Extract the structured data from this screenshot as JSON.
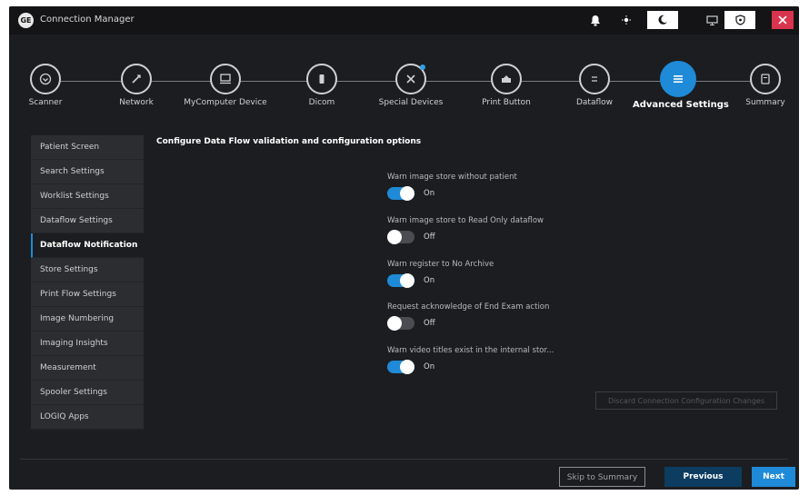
{
  "window": {
    "title": "Connection Manager",
    "logo_text": "GE"
  },
  "titlebar": {
    "icons": [
      "bell-icon",
      "sun-icon",
      "moon-icon",
      "monitor-icon",
      "shield-icon",
      "close-icon"
    ]
  },
  "steps": [
    {
      "label": "Scanner",
      "icon": "scanner-icon"
    },
    {
      "label": "Network",
      "icon": "network-icon"
    },
    {
      "label": "MyComputer Device",
      "icon": "computer-icon"
    },
    {
      "label": "Dicom",
      "icon": "dicom-icon"
    },
    {
      "label": "Special Devices",
      "icon": "tools-icon"
    },
    {
      "label": "Print Button",
      "icon": "printer-icon"
    },
    {
      "label": "Dataflow",
      "icon": "dataflow-icon"
    },
    {
      "label": "Advanced Settings",
      "icon": "list-icon"
    },
    {
      "label": "Summary",
      "icon": "summary-icon"
    }
  ],
  "active_step": "Advanced Settings",
  "sidebar": {
    "items": [
      {
        "label": "Patient Screen"
      },
      {
        "label": "Search Settings"
      },
      {
        "label": "Worklist Settings"
      },
      {
        "label": "Dataflow Settings"
      },
      {
        "label": "Dataflow Notification"
      },
      {
        "label": "Store Settings"
      },
      {
        "label": "Print Flow Settings"
      },
      {
        "label": "Image Numbering"
      },
      {
        "label": "Imaging Insights"
      },
      {
        "label": "Measurement"
      },
      {
        "label": "Spooler Settings"
      },
      {
        "label": "LOGIQ Apps"
      }
    ],
    "active": "Dataflow Notification"
  },
  "main": {
    "heading": "Configure Data Flow validation and configuration options",
    "options": [
      {
        "label": "Warn image store without patient",
        "state": "On"
      },
      {
        "label": "Warn image store to Read Only dataflow",
        "state": "Off"
      },
      {
        "label": "Warn register to No Archive",
        "state": "On"
      },
      {
        "label": "Request acknowledge of End Exam action",
        "state": "Off"
      },
      {
        "label": "Warn video titles exist in the internal stor...",
        "state": "On"
      }
    ],
    "discard_label": "Discard Connection Configuration Changes"
  },
  "footer": {
    "skip_label": "Skip to Summary",
    "previous_label": "Previous",
    "next_label": "Next"
  },
  "colors": {
    "accent": "#1f8ad7",
    "background": "#1c1d20",
    "titlebar": "#141416",
    "close": "#d9344e"
  }
}
